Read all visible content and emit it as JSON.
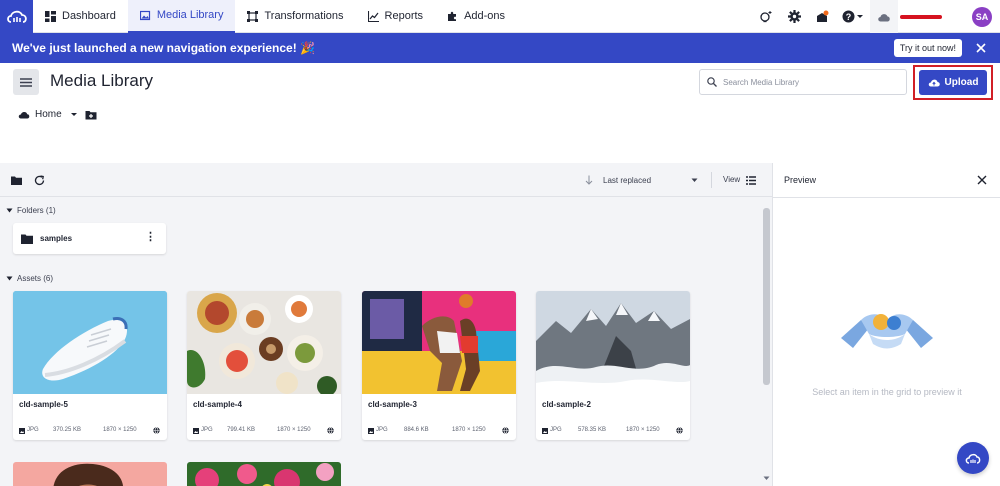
{
  "nav": {
    "items": [
      {
        "label": "Dashboard",
        "icon": "dashboard-icon",
        "active": false
      },
      {
        "label": "Media Library",
        "icon": "media-library-icon",
        "active": true
      },
      {
        "label": "Transformations",
        "icon": "transformations-icon",
        "active": false
      },
      {
        "label": "Reports",
        "icon": "reports-icon",
        "active": false
      },
      {
        "label": "Add-ons",
        "icon": "puzzle-icon",
        "active": false
      }
    ],
    "avatar_initials": "SA",
    "accent": "#3448c5",
    "avatar_color": "#8a3fc4"
  },
  "banner": {
    "text": "We've just launched a new navigation experience! 🎉",
    "try_label": "Try it out now!"
  },
  "header": {
    "title": "Media Library",
    "search_placeholder": "Search Media Library",
    "upload_label": "Upload"
  },
  "breadcrumb": {
    "home_label": "Home"
  },
  "toolbar": {
    "sort_label": "Last replaced",
    "view_label": "View"
  },
  "folders": {
    "label": "Folders (1)",
    "items": [
      {
        "name": "samples"
      }
    ]
  },
  "assets": {
    "label": "Assets (6)",
    "items": [
      {
        "name": "cld-sample-5",
        "format": "JPG",
        "size": "370.25 KB",
        "dimensions": "1870 × 1250"
      },
      {
        "name": "cld-sample-4",
        "format": "JPG",
        "size": "799.41 KB",
        "dimensions": "1870 × 1250"
      },
      {
        "name": "cld-sample-3",
        "format": "JPG",
        "size": "884.6 KB",
        "dimensions": "1870 × 1250"
      },
      {
        "name": "cld-sample-2",
        "format": "JPG",
        "size": "578.35 KB",
        "dimensions": "1870 × 1250"
      }
    ]
  },
  "preview": {
    "title": "Preview",
    "hint": "Select an item in the grid to preview it"
  }
}
